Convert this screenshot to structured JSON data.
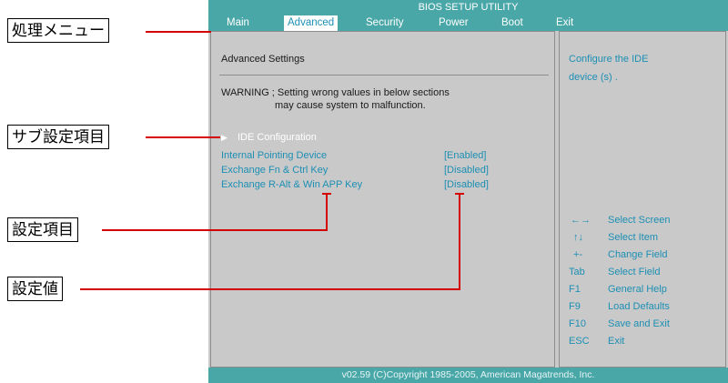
{
  "bios": {
    "title": "BIOS SETUP UTILITY",
    "menu": [
      "Main",
      "Advanced",
      "Security",
      "Power",
      "Boot",
      "Exit"
    ],
    "section_title": "Advanced Settings",
    "warning_line1": "WARNING ; Setting wrong values in below sections",
    "warning_line2": "may cause system to malfunction.",
    "submenu_label": "IDE Configuration",
    "items": [
      {
        "label": "Internal Pointing Device",
        "value": "[Enabled]"
      },
      {
        "label": "Exchange Fn & Ctrl Key",
        "value": "[Disabled]"
      },
      {
        "label": "Exchange R-Alt & Win APP Key",
        "value": "[Disabled]"
      }
    ],
    "help_line1": "Configure the IDE",
    "help_line2": "device (s) .",
    "keys": [
      {
        "key": "←→",
        "desc": "Select Screen"
      },
      {
        "key": "↑↓",
        "desc": "Select Item"
      },
      {
        "key": "+-",
        "desc": "Change Field"
      },
      {
        "key": "Tab",
        "desc": "Select Field"
      },
      {
        "key": "F1",
        "desc": "General Help"
      },
      {
        "key": "F9",
        "desc": "Load Defaults"
      },
      {
        "key": "F10",
        "desc": "Save and Exit"
      },
      {
        "key": "ESC",
        "desc": "Exit"
      }
    ],
    "footer": "v02.59 (C)Copyright 1985-2005, American Magatrends, Inc."
  },
  "callouts": {
    "menu": "処理メニュー",
    "submenu": "サブ設定項目",
    "item": "設定項目",
    "value": "設定値"
  },
  "colors": {
    "bios_bar": "#4aa7a8",
    "bios_bg": "#c9c9c9",
    "item_text": "#1c8fb4",
    "leader": "#d40000"
  }
}
